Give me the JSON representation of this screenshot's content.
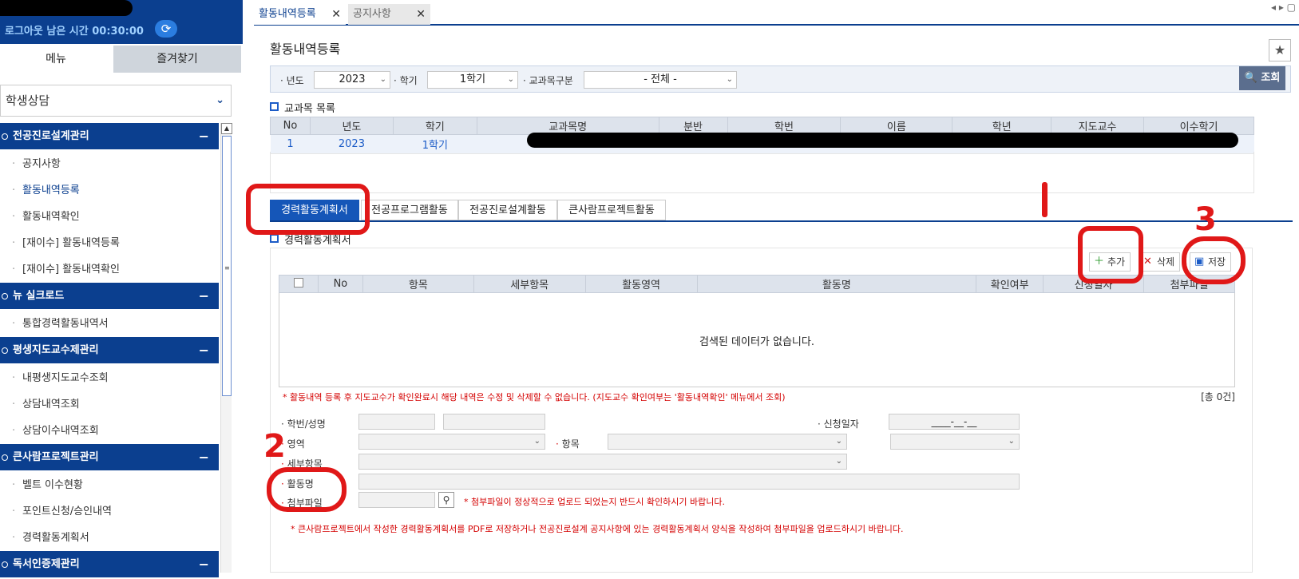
{
  "sidebar": {
    "logout_text": "로그아웃 남은 시간 00:30:00",
    "tab_menu": "메뉴",
    "tab_favorites": "즐겨찾기",
    "category": "학생상담",
    "groups": [
      {
        "title": "전공진로설계관리",
        "items": [
          "공지사항",
          "활동내역등록",
          "활동내역확인",
          "[재이수] 활동내역등록",
          "[재이수] 활동내역확인"
        ]
      },
      {
        "title": "뉴 실크로드",
        "items": [
          "통합경력활동내역서"
        ]
      },
      {
        "title": "평생지도교수제관리",
        "items": [
          "내평생지도교수조회",
          "상담내역조회",
          "상담이수내역조회"
        ]
      },
      {
        "title": "큰사람프로젝트관리",
        "items": [
          "벨트 이수현황",
          "포인트신청/승인내역",
          "경력활동계획서"
        ]
      },
      {
        "title": "독서인증제관리",
        "items": []
      }
    ]
  },
  "tabs": [
    {
      "label": "활동내역등록"
    },
    {
      "label": "공지사항"
    }
  ],
  "page_title": "활동내역등록",
  "filters": {
    "year_label": "년도",
    "year_value": "2023",
    "semester_label": "학기",
    "semester_value": "1학기",
    "category_label": "교과목구분",
    "category_value": "- 전체 -",
    "search_button": "조회"
  },
  "subject_section_title": "교과목 목록",
  "subject_table": {
    "headers": [
      "No",
      "년도",
      "학기",
      "교과목명",
      "분반",
      "학번",
      "이름",
      "학년",
      "지도교수",
      "이수학기"
    ],
    "rows": [
      {
        "no": "1",
        "year": "2023",
        "semester": "1학기"
      }
    ]
  },
  "content_tabs": [
    "경력활동계획서",
    "전공프로그램활동",
    "전공진로설계활동",
    "큰사람프로젝트활동"
  ],
  "section2_title": "경력활동계획서",
  "actions": {
    "add": "추가",
    "delete": "삭제",
    "save": "저장"
  },
  "activity_table": {
    "headers": [
      "",
      "No",
      "항목",
      "세부항목",
      "활동영역",
      "활동명",
      "확인여부",
      "신청일자",
      "첨부파일"
    ],
    "empty_text": "검색된 데이터가 없습니다."
  },
  "notice_1": "* 활동내역 등록 후 지도교수가 확인완료시 해당 내역은 수정 및 삭제할 수 없습니다. (지도교수 확인여부는 '활동내역확인' 메뉴에서 조회)",
  "total_count": "[총 0건]",
  "form": {
    "student_label": "학번/성명",
    "request_date_label": "신청일자",
    "request_date_value": "____-__-__",
    "area_label": "영역",
    "item_label": "항목",
    "detail_label": "세부항목",
    "activity_name_label": "활동명",
    "attachment_label": "첨부파일"
  },
  "notice_2": "* 첨부파일이 정상적으로 업로드 되었는지 반드시 확인하시기 바랍니다.",
  "notice_3": "* 큰사람프로젝트에서 작성한 경력활동계획서를 PDF로 저장하거나 전공진로설계 공지사항에 있는 경력활동계획서 양식을 작성하여 첨부파일을 업로드하시기 바랍니다.",
  "annotations": [
    "1",
    "2",
    "3"
  ],
  "colors": {
    "brand_blue": "#0b3f8f",
    "tab_active": "#1556b8",
    "notice_red": "#d40000",
    "annotation_red": "#e01818"
  }
}
